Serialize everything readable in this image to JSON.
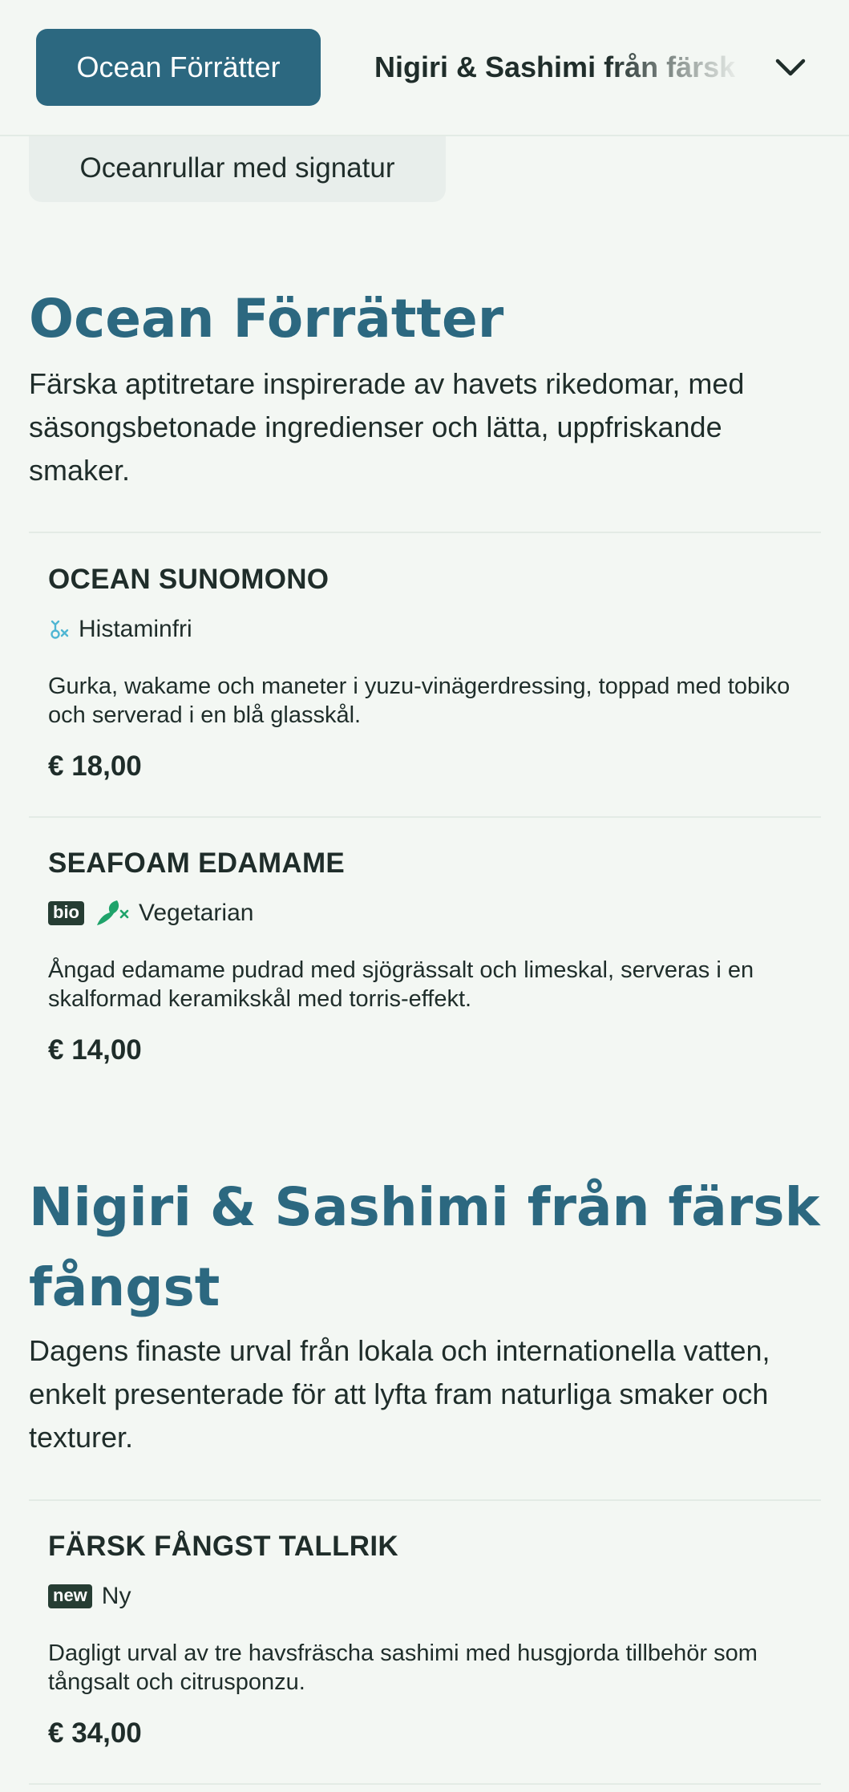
{
  "category_bar": {
    "active_tab": "Ocean Förrätter",
    "next_tab": "Nigiri & Sashimi från färsk fångst",
    "second_row_tab": "Oceanrullar med signatur"
  },
  "sections": [
    {
      "title": "Ocean Förrätter",
      "description": "Färska aptitretare inspirerade av havets rikedomar, med säsongsbetonade ingredienser och lätta, uppfriskande smaker.",
      "items": [
        {
          "name": "OCEAN SUNOMONO",
          "tags": [
            "Histaminfri"
          ],
          "description": "Gurka, wakame och maneter i yuzu-vinägerdressing, toppad med tobiko och serverad i en blå glasskål.",
          "price": "€ 18,00"
        },
        {
          "name": "SEAFOAM EDAMAME",
          "badges": [
            "bio"
          ],
          "tags": [
            "Vegetarian"
          ],
          "description": "Ångad edamame pudrad med sjögrässalt och limeskal, serveras i en skalformad keramikskål med torris-effekt.",
          "price": "€ 14,00"
        }
      ]
    },
    {
      "title": "Nigiri & Sashimi från färsk fångst",
      "description": "Dagens finaste urval från lokala och internationella vatten, enkelt presenterade för att lyfta fram naturliga smaker och texturer.",
      "items": [
        {
          "name": "FÄRSK FÅNGST TALLRIK",
          "badges": [
            "new"
          ],
          "tags": [
            "Ny"
          ],
          "description": "Dagligt urval av tre havsfräscha sashimi med husgjorda tillbehör som tångsalt och citrusponzu.",
          "price": "€ 34,00"
        }
      ]
    }
  ],
  "icons": {
    "histamine": "histamine-free-icon",
    "vegetarian": "vegetarian-icon",
    "chevron": "chevron-down-icon"
  },
  "colors": {
    "accent": "#2c6880",
    "background": "#f3f7f3",
    "badge": "#263d33",
    "histamine_icon": "#4fb6d3",
    "vegetarian_icon": "#1fa36a"
  }
}
